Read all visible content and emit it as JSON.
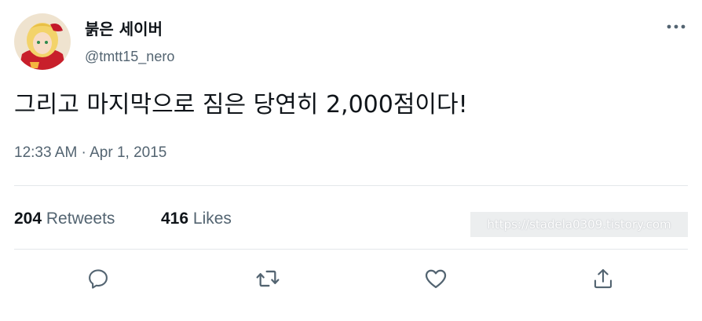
{
  "author": {
    "display_name": "붉은 세이버",
    "handle": "@tmtt15_nero"
  },
  "tweet": {
    "text": "그리고 마지막으로 짐은 당연히 2,000점이다!",
    "timestamp": "12:33 AM · Apr 1, 2015"
  },
  "stats": {
    "retweets": {
      "count": "204",
      "label": "Retweets"
    },
    "likes": {
      "count": "416",
      "label": "Likes"
    }
  },
  "watermark": "https://stadela0309.tistory.com",
  "actions": {
    "reply_icon": "reply-icon",
    "retweet_icon": "retweet-icon",
    "like_icon": "heart-icon",
    "share_icon": "share-icon",
    "more_icon": "more-icon"
  },
  "colors": {
    "text_primary": "#0f1419",
    "text_secondary": "#536471",
    "divider": "#e4e7ea",
    "icon": "#536471"
  }
}
